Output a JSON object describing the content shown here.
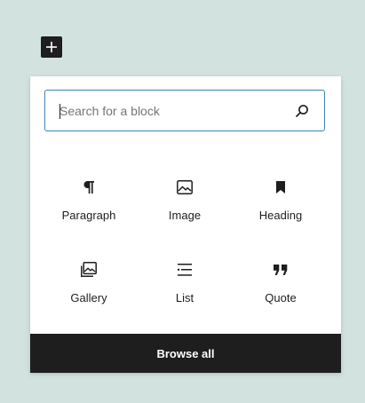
{
  "inserter_toggle": {
    "icon": "plus-icon"
  },
  "search": {
    "placeholder": "Search for a block",
    "value": "",
    "icon": "search-icon",
    "focus_color": "#3b84b0"
  },
  "blocks": [
    {
      "label": "Paragraph",
      "icon": "paragraph-icon"
    },
    {
      "label": "Image",
      "icon": "image-icon"
    },
    {
      "label": "Heading",
      "icon": "bookmark-icon"
    },
    {
      "label": "Gallery",
      "icon": "gallery-icon"
    },
    {
      "label": "List",
      "icon": "list-icon"
    },
    {
      "label": "Quote",
      "icon": "quote-icon"
    }
  ],
  "footer": {
    "browse_label": "Browse all"
  },
  "colors": {
    "background": "#d2e3df",
    "dark": "#1e1e1e",
    "panel": "#ffffff"
  }
}
